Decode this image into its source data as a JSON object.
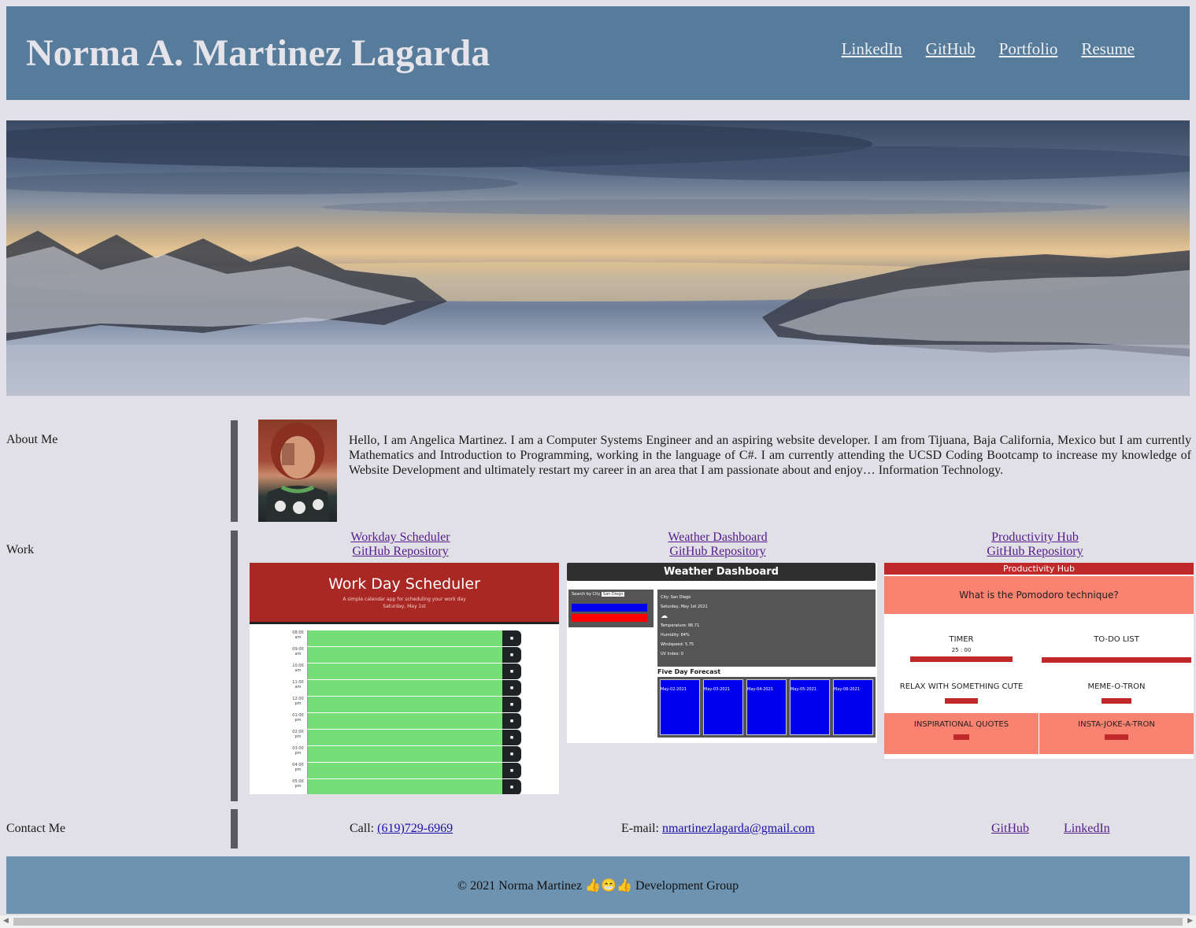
{
  "header": {
    "title": "Norma A. Martinez Lagarda",
    "nav": [
      "LinkedIn",
      "GitHub",
      "Portfolio",
      "Resume"
    ]
  },
  "about": {
    "label": "About Me",
    "text": "Hello, I am Angelica Martinez. I am a Computer Systems Engineer and an aspiring website developer. I am from Tijuana, Baja California, Mexico but I am currently Mathematics and Introduction to Programming, working in the language of C#. I am currently attending the UCSD Coding Bootcamp to increase my knowledge of Website Development and ultimately restart my career in an area that I am passionate about and enjoy… Information Technology."
  },
  "work": {
    "label": "Work",
    "projects": [
      {
        "title": "Workday Scheduler",
        "repo": "GitHub Repository",
        "shot_title": "Work Day Scheduler",
        "shot_sub": "A simple calendar app for scheduling your work day",
        "shot_date": "Saturday, May 1st",
        "hours": [
          "08:00 am",
          "09:00 am",
          "10:00 am",
          "11:00 am",
          "12:00 pm",
          "01:00 pm",
          "02:00 pm",
          "03:00 pm",
          "04:00 pm",
          "05:00 pm"
        ]
      },
      {
        "title": "Weather Dashboard",
        "repo": "GitHub Repository",
        "shot_title": "Weather Dashboard",
        "shot_search_label": "Search by City",
        "shot_search_value": "San Diego",
        "shot_current": [
          "City: San Diego",
          "Saturday, May 1st 2021",
          "☁",
          "Temperature: 86.71",
          "Humidity: 84%",
          "Windspeed: 5.75",
          "UV Index: 0"
        ],
        "shot_forecast": "Five Day Forecast",
        "shot_days": [
          "May-02-2021",
          "May-03-2021",
          "May-04-2021",
          "May-05-2021",
          "May-06-2021"
        ]
      },
      {
        "title": "Productivity Hub",
        "repo": "GitHub Repository",
        "shot_title": "Productivity Hub",
        "shot_question": "What is the Pomodoro technique?",
        "shot_timer": "TIMER",
        "shot_time": "25 : 00",
        "shot_todo": "TO-DO LIST",
        "shot_cute": "RELAX WITH SOMETHING CUTE",
        "shot_meme": "MEME-O-TRON",
        "shot_quotes": "INSPIRATIONAL QUOTES",
        "shot_joke": "INSTA-JOKE-A-TRON"
      }
    ]
  },
  "contact": {
    "label": "Contact Me",
    "call_label": "Call: ",
    "phone": "(619)729-6969",
    "email_label": "E-mail: ",
    "email": "nmartinezlagarda@gmail.com",
    "github": "GitHub",
    "linkedin": "LinkedIn"
  },
  "footer": {
    "text": "© 2021 Norma Martinez 👍😁👍 Development Group"
  },
  "colors": {
    "header_bg": "#577b9a",
    "footer_bg": "#6e93b0",
    "page_bg": "#e0e0e6",
    "bar": "#5a5a62"
  }
}
